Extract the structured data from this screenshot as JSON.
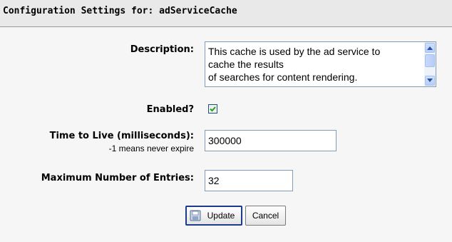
{
  "header": {
    "title": "Configuration Settings for:  adServiceCache"
  },
  "form": {
    "description_label": "Description:",
    "description_value": "This cache is used by the ad service to\ncache the results\nof searches for content rendering.",
    "enabled_label": "Enabled?",
    "enabled_checked": true,
    "ttl_label": "Time to Live (milliseconds):",
    "ttl_hint": "-1 means never expire",
    "ttl_value": "300000",
    "max_entries_label": "Maximum Number of Entries:",
    "max_entries_value": "32"
  },
  "buttons": {
    "update_label": "Update",
    "cancel_label": "Cancel"
  },
  "icons": {
    "scroll_up": "arrow-up-icon",
    "scroll_down": "arrow-down-icon",
    "check": "checkmark-icon",
    "save": "floppy-disk-icon"
  },
  "colors": {
    "checkmark": "#21a121",
    "input_border": "#7f9db9",
    "scrollbar": "#b6cdf7",
    "update_border": "#1d3b8c"
  }
}
